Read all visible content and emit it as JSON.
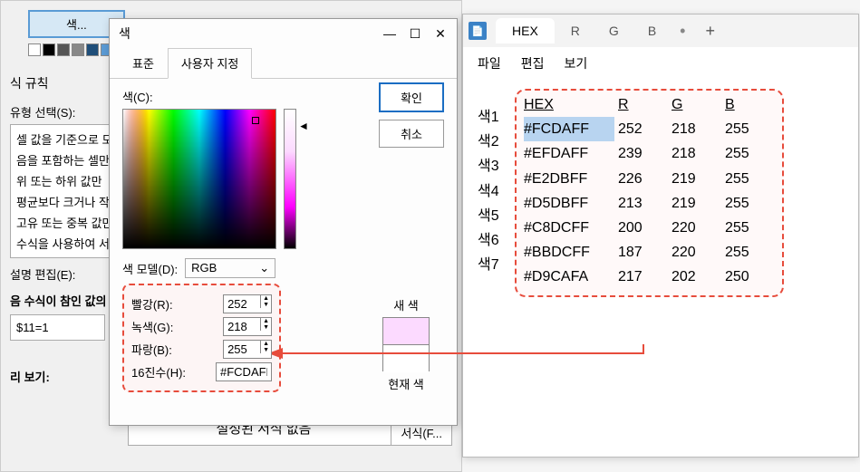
{
  "bg": {
    "top_button": "색...",
    "section_rules": "식 규칙",
    "type_select_label": "유형 선택(S):",
    "list_items": [
      "셀 값을 기준으로 모",
      "음을 포함하는 셀만",
      "위 또는 하위 값만",
      "평균보다 크거나 작은",
      "고유 또는 중복 값만",
      "수식을 사용하여 서식"
    ],
    "edit_desc_label": "설명 편집(E):",
    "formula_label": "음 수식이 참인 값의",
    "formula_value": "$11=1",
    "preview_label": "리 보기:",
    "no_format": "설정된 서식 없음",
    "format_btn": "서식(F..."
  },
  "color_dialog": {
    "title": "색",
    "tab_standard": "표준",
    "tab_custom": "사용자 지정",
    "ok": "확인",
    "cancel": "취소",
    "color_label": "색(C):",
    "model_label": "색 모델(D):",
    "model_value": "RGB",
    "red_label": "빨강(R):",
    "red_value": "252",
    "green_label": "녹색(G):",
    "green_value": "218",
    "blue_label": "파랑(B):",
    "blue_value": "255",
    "hex_label": "16진수(H):",
    "hex_value": "#FCDAFF",
    "new_label": "새 색",
    "current_label": "현재 색"
  },
  "notepad": {
    "tab_active": "HEX",
    "tab_r": "R",
    "tab_g": "G",
    "tab_b": "B",
    "menu_file": "파일",
    "menu_edit": "편집",
    "menu_view": "보기",
    "headers": {
      "hex": "HEX",
      "r": "R",
      "g": "G",
      "b": "B"
    },
    "rows": [
      {
        "label": "색1",
        "hex": "#FCDAFF",
        "r": "252",
        "g": "218",
        "b": "255",
        "hl": true
      },
      {
        "label": "색2",
        "hex": "#EFDAFF",
        "r": "239",
        "g": "218",
        "b": "255"
      },
      {
        "label": "색3",
        "hex": "#E2DBFF",
        "r": "226",
        "g": "219",
        "b": "255"
      },
      {
        "label": "색4",
        "hex": "#D5DBFF",
        "r": "213",
        "g": "219",
        "b": "255"
      },
      {
        "label": "색5",
        "hex": "#C8DCFF",
        "r": "200",
        "g": "220",
        "b": "255"
      },
      {
        "label": "색6",
        "hex": "#BBDCFF",
        "r": "187",
        "g": "220",
        "b": "255"
      },
      {
        "label": "색7",
        "hex": "#D9CAFA",
        "r": "217",
        "g": "202",
        "b": "250"
      }
    ]
  }
}
